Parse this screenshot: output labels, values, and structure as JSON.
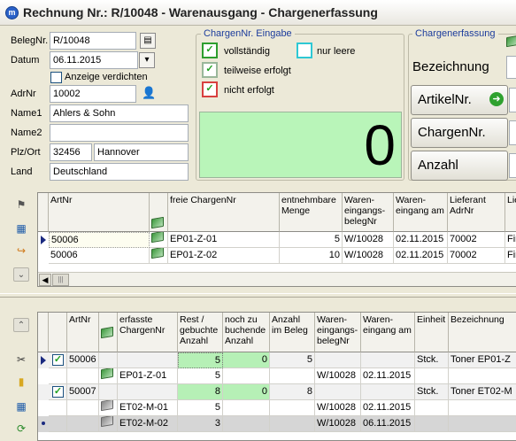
{
  "window": {
    "title": "Rechnung Nr.: R/10048 - Warenausgang - Chargenerfassung"
  },
  "form": {
    "belegnr_label": "BelegNr.",
    "belegnr_value": "R/10048",
    "datum_label": "Datum",
    "datum_value": "06.11.2015",
    "anzeige_label": "Anzeige verdichten",
    "adrnr_label": "AdrNr",
    "adrnr_value": "10002",
    "name1_label": "Name1",
    "name1_value": "Ahlers & Sohn",
    "name2_label": "Name2",
    "name2_value": "",
    "plzort_label": "Plz/Ort",
    "plz_value": "32456",
    "ort_value": "Hannover",
    "land_label": "Land",
    "land_value": "Deutschland"
  },
  "eingabe": {
    "title": "ChargenNr. Eingabe",
    "vollstaendig": "vollständig",
    "nur_leere": "nur leere",
    "teilweise": "teilweise erfolgt",
    "nicht": "nicht erfolgt",
    "counter": "0",
    "colors": {
      "green": "#2e9e2e",
      "cyan": "#2ec8d4",
      "red": "#d84040",
      "counter_bg": "#b9f5b9"
    }
  },
  "chargenerfassung": {
    "title": "Chargenerfassung",
    "bezeichnung": "Bezeichnung",
    "artikelnr": "ArtikelNr.",
    "chargennr": "ChargenNr.",
    "anzahl": "Anzahl"
  },
  "top_grid": {
    "headers": [
      "ArtNr",
      "",
      "freie ChargenNr",
      "entnehmbare Menge",
      "Waren-eingangs-belegNr",
      "Waren-eingang am",
      "Lieferant AdrNr",
      "Lie"
    ],
    "rows": [
      {
        "artnr": "50006",
        "charge": "EP01-Z-01",
        "menge": "5",
        "beleg": "W/10028",
        "datum": "02.11.2015",
        "lief": "70002",
        "lie": "Fir"
      },
      {
        "artnr": "50006",
        "charge": "EP01-Z-02",
        "menge": "10",
        "beleg": "W/10028",
        "datum": "02.11.2015",
        "lief": "70002",
        "lie": "Fir"
      }
    ]
  },
  "bottom_grid": {
    "headers": [
      "ArtNr",
      "",
      "erfasste ChargenNr",
      "Rest / gebuchte Anzahl",
      "noch zu buchende Anzahl",
      "Anzahl im Beleg",
      "Waren-eingangs-belegNr",
      "Waren-eingang am",
      "Einheit",
      "Bezeichnung"
    ],
    "rows": [
      {
        "artnr": "50006",
        "charge": "",
        "rest": "5",
        "noch": "0",
        "anzahl": "5",
        "beleg": "",
        "datum": "",
        "einheit": "Stck.",
        "bez": "Toner EP01-Z"
      },
      {
        "artnr": "",
        "charge": "EP01-Z-01",
        "rest": "5",
        "noch": "",
        "anzahl": "",
        "beleg": "W/10028",
        "datum": "02.11.2015",
        "einheit": "",
        "bez": ""
      },
      {
        "artnr": "50007",
        "charge": "",
        "rest": "8",
        "noch": "0",
        "anzahl": "8",
        "beleg": "",
        "datum": "",
        "einheit": "Stck.",
        "bez": "Toner ET02-M"
      },
      {
        "artnr": "",
        "charge": "ET02-M-01",
        "rest": "5",
        "noch": "",
        "anzahl": "",
        "beleg": "W/10028",
        "datum": "02.11.2015",
        "einheit": "",
        "bez": ""
      },
      {
        "artnr": "",
        "charge": "ET02-M-02",
        "rest": "3",
        "noch": "",
        "anzahl": "",
        "beleg": "W/10028",
        "datum": "06.11.2015",
        "einheit": "",
        "bez": ""
      }
    ]
  }
}
